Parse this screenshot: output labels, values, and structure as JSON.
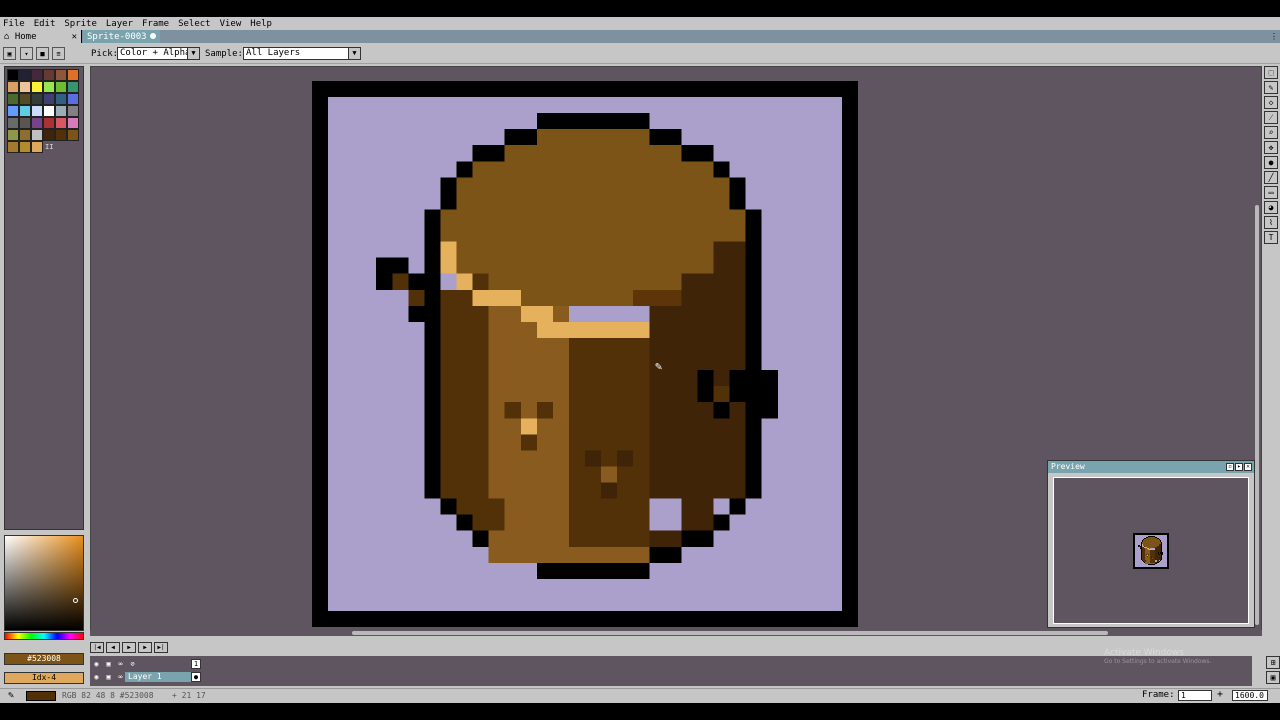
{
  "menu": [
    {
      "label": "File"
    },
    {
      "label": "Edit"
    },
    {
      "label": "Sprite"
    },
    {
      "label": "Layer"
    },
    {
      "label": "Frame"
    },
    {
      "label": "Select"
    },
    {
      "label": "View"
    },
    {
      "label": "Help"
    }
  ],
  "tabs": {
    "home": "Home",
    "sprite": "Sprite-0003"
  },
  "context_bar": {
    "pick_label": "Pick:",
    "pick_value": "Color + Alpha",
    "sample_label": "Sample:",
    "sample_value": "All Layers"
  },
  "palette": {
    "colors": [
      "#000000",
      "#222034",
      "#45283c",
      "#663931",
      "#8f563b",
      "#df7126",
      "#d9a066",
      "#eec39a",
      "#fbf236",
      "#99e550",
      "#6abe30",
      "#37946e",
      "#4b692f",
      "#524b24",
      "#323c39",
      "#3f3f74",
      "#306082",
      "#5b6ee1",
      "#639bff",
      "#5fcde4",
      "#cbdbfc",
      "#ffffff",
      "#9badb7",
      "#847e87",
      "#696a6a",
      "#595652",
      "#76428a",
      "#ac3232",
      "#d95763",
      "#d77bba",
      "#8f974a",
      "#8a6f30",
      "#c0c0c0",
      "#40240a",
      "#523008",
      "#7d5417",
      "#a57a2a",
      "#b48a2a",
      "#e0a85c"
    ],
    "count": "II"
  },
  "color": {
    "hex": "#523008",
    "index": "Idx-4",
    "primary": "#523008"
  },
  "preview": {
    "title": "Preview"
  },
  "layers": {
    "name": "Layer 1",
    "frame_no": "1"
  },
  "status": {
    "rgb": "RGB  82  48  8  #523008",
    "pos": "+ 21 17"
  },
  "frame": {
    "label": "Frame:",
    "value": "1",
    "zoom": "1600.0"
  },
  "watermark": {
    "title": "Activate Windows",
    "sub": "Go to Settings to activate Windows."
  }
}
